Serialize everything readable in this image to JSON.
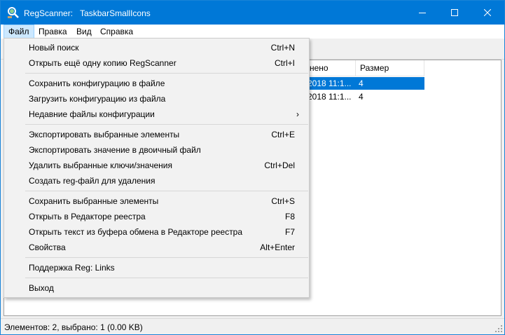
{
  "window": {
    "app_name": "RegScanner:",
    "subtitle": "TaskbarSmallIcons"
  },
  "menubar": {
    "items": [
      {
        "label": "Файл"
      },
      {
        "label": "Правка"
      },
      {
        "label": "Вид"
      },
      {
        "label": "Справка"
      }
    ]
  },
  "list": {
    "columns": [
      {
        "label": "нено"
      },
      {
        "label": "Размер"
      }
    ],
    "rows": [
      {
        "modified": "2018 11:1...",
        "size": "4",
        "selected": true
      },
      {
        "modified": "2018 11:1...",
        "size": "4",
        "selected": false
      }
    ]
  },
  "file_menu": {
    "items": [
      {
        "label": "Новый поиск",
        "shortcut": "Ctrl+N"
      },
      {
        "label": "Открыть ещё одну копию RegScanner",
        "shortcut": "Ctrl+I"
      },
      {
        "label": "Сохранить конфигурацию в файле",
        "shortcut": ""
      },
      {
        "label": "Загрузить конфигурацию из файла",
        "shortcut": ""
      },
      {
        "label": "Недавние файлы конфигурации",
        "shortcut": "",
        "submenu": true
      },
      {
        "label": "Экспортировать выбранные элементы",
        "shortcut": "Ctrl+E"
      },
      {
        "label": "Экспортировать значение в двоичный файл",
        "shortcut": ""
      },
      {
        "label": "Удалить выбранные ключи/значения",
        "shortcut": "Ctrl+Del"
      },
      {
        "label": "Создать reg-файл для удаления",
        "shortcut": ""
      },
      {
        "label": "Сохранить выбранные элементы",
        "shortcut": "Ctrl+S"
      },
      {
        "label": "Открыть в Редакторе реестра",
        "shortcut": "F8"
      },
      {
        "label": "Открыть текст из буфера обмена в Редакторе реестра",
        "shortcut": "F7"
      },
      {
        "label": "Свойства",
        "shortcut": "Alt+Enter"
      },
      {
        "label": "Поддержка Reg: Links",
        "shortcut": ""
      },
      {
        "label": "Выход",
        "shortcut": ""
      }
    ],
    "submenu_arrow": "›"
  },
  "status": {
    "text": "Элементов: 2, выбрано: 1  (0.00 KB)"
  },
  "colors": {
    "accent": "#0078d7",
    "menu_highlight": "#cce8ff",
    "menu_bg": "#f2f2f2"
  },
  "icons": [
    "regscanner-app-icon",
    "minimize-icon",
    "maximize-icon",
    "close-icon",
    "chevron-right-icon",
    "size-grip-icon"
  ]
}
